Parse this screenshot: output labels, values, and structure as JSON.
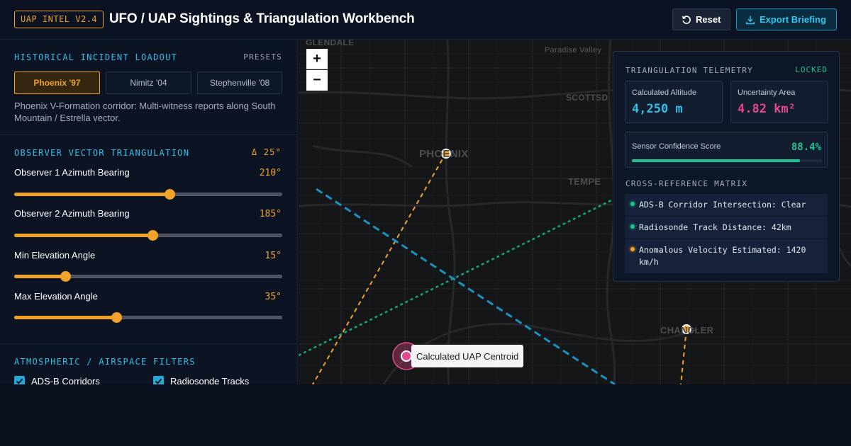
{
  "header": {
    "badge": "UAP INTEL V2.4",
    "title": "UFO / UAP Sightings & Triangulation Workbench",
    "reset_label": "Reset",
    "export_label": "Export Briefing"
  },
  "loadout": {
    "title": "HISTORICAL INCIDENT LOADOUT",
    "presets_label": "PRESETS",
    "presets": [
      "Phoenix '97",
      "Nimitz '04",
      "Stephenville '08"
    ],
    "active_preset": 0,
    "description": "Phoenix V-Formation corridor: Multi-witness reports along South Mountain / Estrella vector."
  },
  "triangulation": {
    "title": "OBSERVER VECTOR TRIANGULATION",
    "delta": "Δ 25°",
    "sliders": [
      {
        "label": "Observer 1 Azimuth Bearing",
        "value": "210°",
        "fraction": 0.58
      },
      {
        "label": "Observer 2 Azimuth Bearing",
        "value": "185°",
        "fraction": 0.515
      },
      {
        "label": "Min Elevation Angle",
        "value": "15°",
        "fraction": 0.19
      },
      {
        "label": "Max Elevation Angle",
        "value": "35°",
        "fraction": 0.38
      }
    ]
  },
  "filters": {
    "title": "ATMOSPHERIC / AIRSPACE FILTERS",
    "items": [
      {
        "label": "ADS-B Corridors",
        "checked": true
      },
      {
        "label": "Radiosonde Tracks",
        "checked": true
      }
    ]
  },
  "map": {
    "zoom_in": "+",
    "zoom_out": "−",
    "cities": [
      "GLENDALE",
      "Paradise Valley",
      "SCOTTSD",
      "PHOENIX",
      "TEMPE",
      "CHANDLER"
    ],
    "centroid_label": "Calculated UAP Centroid"
  },
  "telemetry": {
    "title": "TRIANGULATION TELEMETRY",
    "status": "LOCKED",
    "altitude_label": "Calculated Altitude",
    "altitude_value": "4,250 m",
    "area_label": "Uncertainty Area",
    "area_value": "4.82 km²",
    "confidence_label": "Sensor Confidence Score",
    "confidence_value": "88.4%",
    "confidence_fraction": 0.884,
    "xref_title": "CROSS-REFERENCE MATRIX",
    "xref": [
      {
        "text": "ADS-B Corridor Intersection: Clear",
        "color": "#1fc48f"
      },
      {
        "text": "Radiosonde Track Distance: 42km",
        "color": "#1fc48f"
      },
      {
        "text": "Anomalous Velocity Estimated: 1420 km/h",
        "color": "#f0a22a"
      }
    ]
  },
  "colors": {
    "accent_amber": "#f0a22a",
    "accent_cyan": "#33bde6",
    "accent_green": "#1fc48f",
    "accent_pink": "#e3498a"
  }
}
